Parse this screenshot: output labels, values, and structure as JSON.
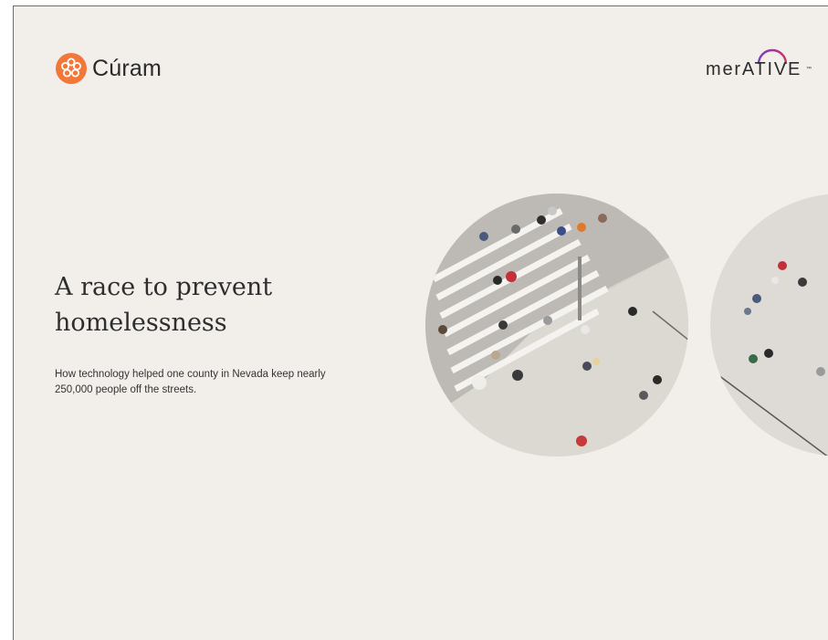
{
  "brand": {
    "curam_name": "Cúram",
    "curam_icon": "curam-flower-icon",
    "curam_color": "#f2783a",
    "partner_name": "merATIVE",
    "partner_tm": "™",
    "partner_arc_colors": [
      "#7a3cc8",
      "#c8326e"
    ]
  },
  "document": {
    "title": "A race to prevent homelessness",
    "subtitle": "How technology helped one county in Nevada keep nearly 250,000 people off the streets."
  },
  "images": {
    "primary": "aerial-crosswalk-pedestrians-photo",
    "secondary": "aerial-plaza-pedestrians-photo"
  },
  "colors": {
    "page_background": "#f2efeb",
    "text": "#2e2e2e"
  }
}
